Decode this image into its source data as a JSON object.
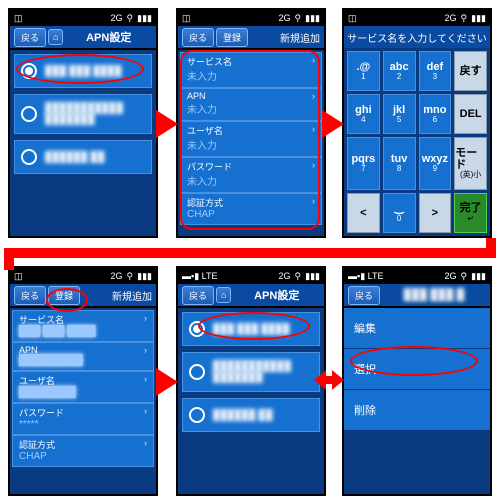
{
  "status": {
    "carrier": "◫",
    "signal": "2G",
    "wifi": "⚲",
    "batt": "▮▮▮"
  },
  "lte": "▬▪▮ LTE",
  "back": "戻る",
  "home_icon": "⌂",
  "register": "登録",
  "screens": {
    "s1": {
      "title": "APN設定",
      "items": [
        "███ ███ ████",
        "███████████\n███████",
        "██████ ██"
      ]
    },
    "s2": {
      "add": "新規追加",
      "fields": [
        {
          "label": "サービス名",
          "value": "未入力"
        },
        {
          "label": "APN",
          "value": "未入力"
        },
        {
          "label": "ユーザ名",
          "value": "未入力"
        },
        {
          "label": "パスワード",
          "value": "未入力"
        },
        {
          "label": "認証方式",
          "value": "CHAP"
        }
      ]
    },
    "s3": {
      "title": "サービス名を入力してください",
      "keys": [
        [
          ".@",
          "1"
        ],
        [
          "abc",
          "2"
        ],
        [
          "def",
          "3"
        ],
        [
          "戻す",
          ""
        ],
        [
          "ghi",
          "4"
        ],
        [
          "jkl",
          "5"
        ],
        [
          "mno",
          "6"
        ],
        [
          "DEL",
          ""
        ],
        [
          "pqrs",
          "7"
        ],
        [
          "tuv",
          "8"
        ],
        [
          "wxyz",
          "9"
        ],
        [
          "モード",
          "(英)小"
        ],
        [
          "<",
          ""
        ],
        [
          "‿",
          "0"
        ],
        [
          ">",
          ""
        ],
        [
          "完了",
          "↵"
        ]
      ]
    },
    "s4": {
      "fields": [
        {
          "label": "サービス名",
          "value": "███ ███ ████"
        },
        {
          "label": "APN",
          "value": "█████████"
        },
        {
          "label": "ユーザ名",
          "value": "████████"
        },
        {
          "label": "パスワード",
          "value": "*****"
        },
        {
          "label": "認証方式",
          "value": "CHAP"
        }
      ]
    },
    "s5": {
      "title": "APN設定",
      "items": [
        "███ ███ ████",
        "███████████\n███████",
        "██████ ██"
      ]
    },
    "s6": {
      "title": "███ ███ █",
      "items": [
        "編集",
        "選択",
        "削除"
      ]
    }
  }
}
